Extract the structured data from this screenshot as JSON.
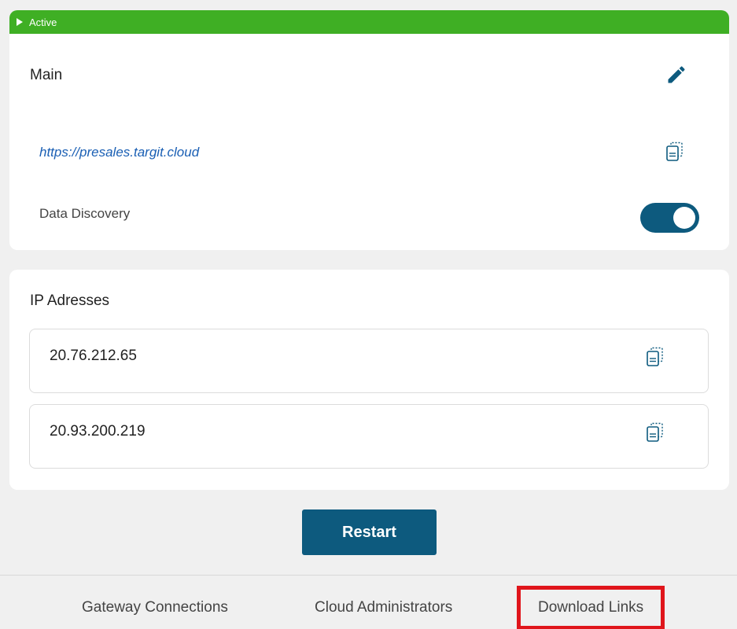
{
  "status": {
    "label": "Active",
    "color": "#3faf24",
    "icon": "play-triangle-icon"
  },
  "main_card": {
    "title": "Main",
    "edit_icon": "pencil-icon",
    "url": "https://presales.targit.cloud",
    "copy_icon": "copy-icon",
    "data_discovery": {
      "label": "Data Discovery",
      "enabled": true
    }
  },
  "ip_card": {
    "title": "IP Adresses",
    "addresses": [
      {
        "value": "20.76.212.65"
      },
      {
        "value": "20.93.200.219"
      }
    ]
  },
  "restart_label": "Restart",
  "accent_color": "#0d5a7e",
  "footer": {
    "links": [
      {
        "label": "Gateway Connections"
      },
      {
        "label": "Cloud Administrators"
      },
      {
        "label": "Download Links",
        "highlighted": true,
        "highlight_color": "#e0151b"
      }
    ]
  }
}
